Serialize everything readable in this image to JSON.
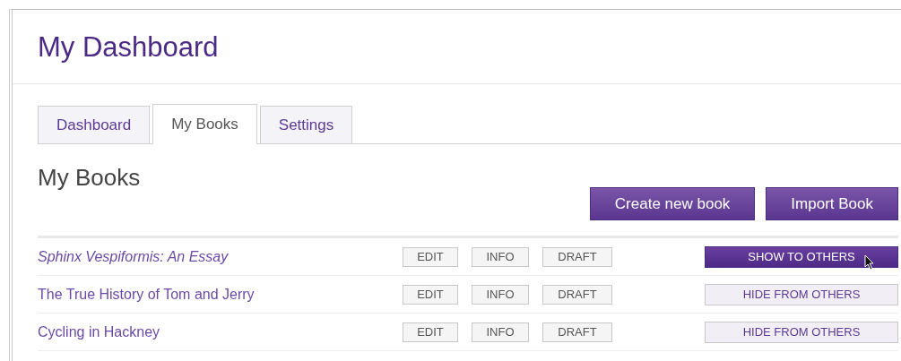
{
  "title": "My Dashboard",
  "tabs": [
    {
      "label": "Dashboard",
      "selected": false
    },
    {
      "label": "My Books",
      "selected": true
    },
    {
      "label": "Settings",
      "selected": false
    }
  ],
  "section_title": "My Books",
  "actions": [
    "Create new book",
    "Import Book"
  ],
  "books": [
    {
      "title": "Sphinx Vespiformis: An Essay",
      "hidden": true,
      "buttons": [
        "EDIT",
        "INFO",
        "DRAFT"
      ],
      "visibility_button": "SHOW TO OTHERS"
    },
    {
      "title": "The True History of Tom and Jerry",
      "hidden": false,
      "buttons": [
        "EDIT",
        "INFO",
        "DRAFT"
      ],
      "visibility_button": "HIDE FROM OTHERS"
    },
    {
      "title": "Cycling in Hackney",
      "hidden": false,
      "buttons": [
        "EDIT",
        "INFO",
        "DRAFT"
      ],
      "visibility_button": "HIDE FROM OTHERS"
    }
  ]
}
